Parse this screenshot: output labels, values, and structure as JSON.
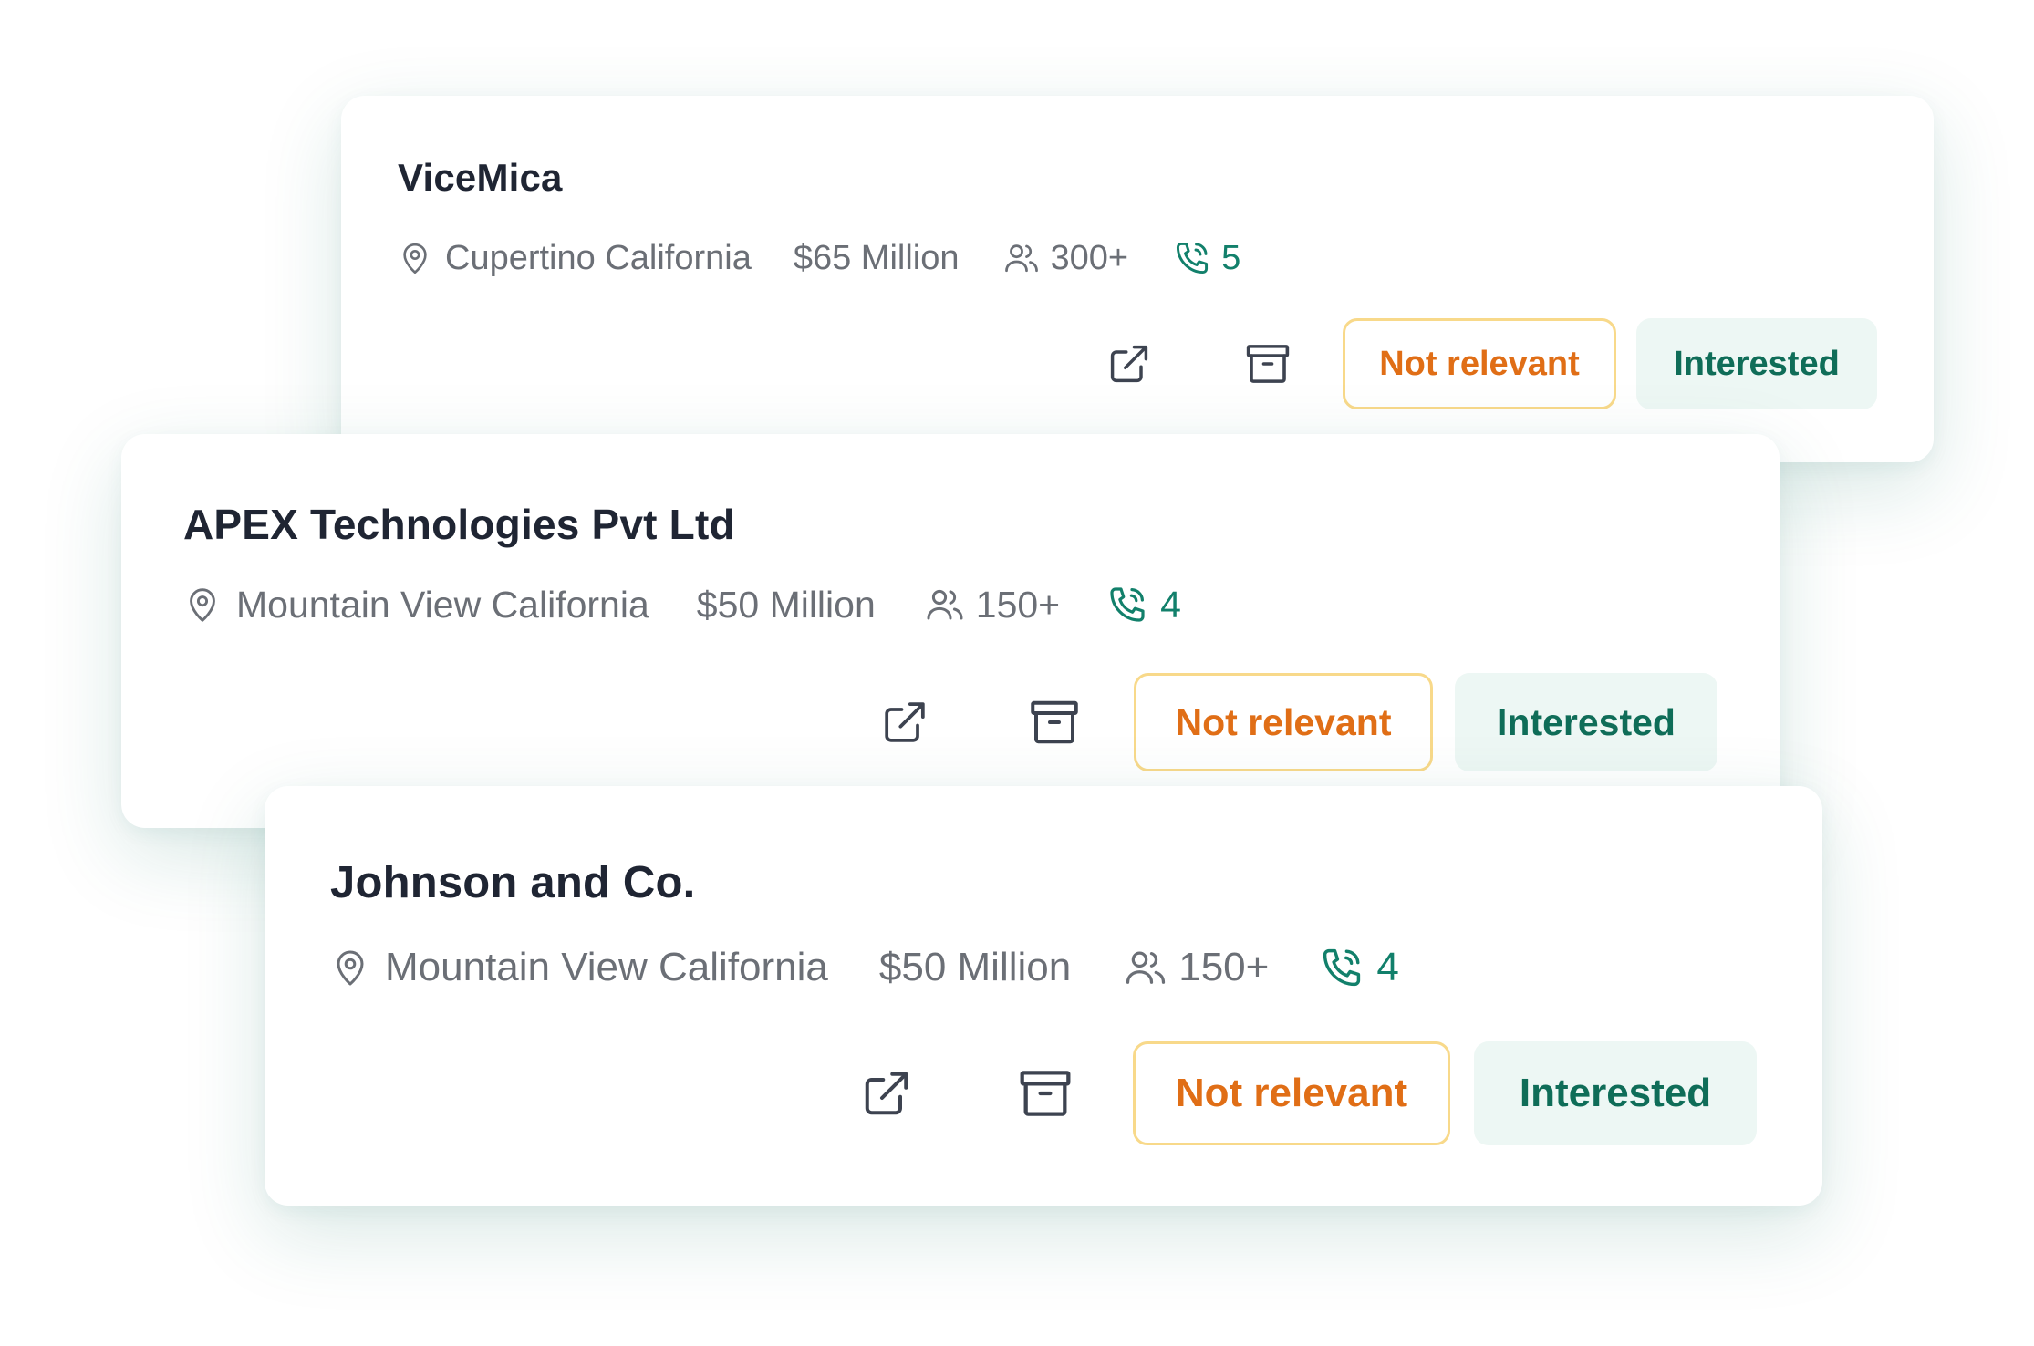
{
  "cards": [
    {
      "name": "ViceMica",
      "location": "Cupertino California",
      "funding": "$65 Million",
      "employees": "300+",
      "calls": "5",
      "not_relevant_label": "Not relevant",
      "interested_label": "Interested"
    },
    {
      "name": "APEX Technologies Pvt Ltd",
      "location": "Mountain View California",
      "funding": "$50 Million",
      "employees": "150+",
      "calls": "4",
      "not_relevant_label": "Not relevant",
      "interested_label": "Interested"
    },
    {
      "name": "Johnson and Co.",
      "location": "Mountain View California",
      "funding": "$50 Million",
      "employees": "150+",
      "calls": "4",
      "not_relevant_label": "Not relevant",
      "interested_label": "Interested"
    }
  ],
  "icons": {
    "location": "location-pin-icon",
    "employees": "users-icon",
    "calls": "phone-call-icon",
    "open": "external-link-icon",
    "archive": "archive-box-icon"
  },
  "colors": {
    "title": "#1f2533",
    "meta_text": "#6b6f76",
    "calls_accent": "#12806b",
    "not_relevant_text": "#e06e16",
    "not_relevant_border": "#f8d98a",
    "interested_bg": "#edf7f4",
    "interested_text": "#0f6d58"
  }
}
